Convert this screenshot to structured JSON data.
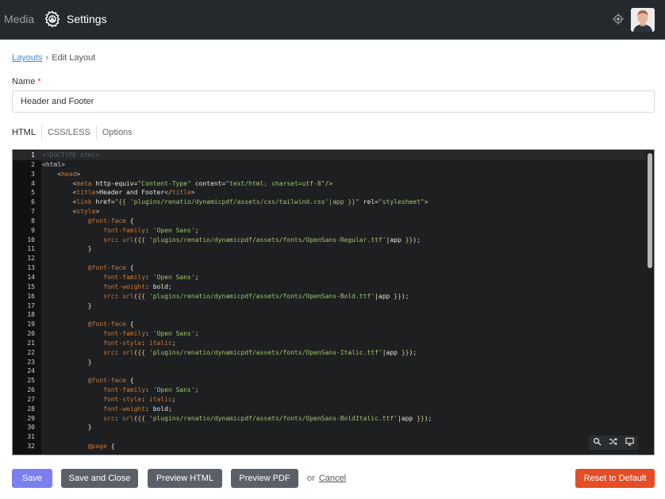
{
  "topbar": {
    "media_label": "Media",
    "settings_label": "Settings",
    "avatar_alt": "User avatar"
  },
  "breadcrumb": {
    "parent": "Layouts",
    "current": "Edit Layout"
  },
  "form": {
    "name_label": "Name",
    "required_mark": "*",
    "name_value": "Header and Footer"
  },
  "tabs": [
    "HTML",
    "CSS/LESS",
    "Options"
  ],
  "editor": {
    "lines": [
      {
        "n": "1",
        "html": "<span class=\"k-comment\">&lt;!DOCTYPE html&gt;</span>"
      },
      {
        "n": "2",
        "html": "<span class=\"k-tag\">&lt;html&gt;</span>"
      },
      {
        "n": "3",
        "html": "    <span class=\"k-tag\">&lt;</span><span class=\"k-tagname\">head</span><span class=\"k-tag\">&gt;</span>"
      },
      {
        "n": "4",
        "html": "        <span class=\"k-tag\">&lt;</span><span class=\"k-tagname\">meta</span> <span class=\"k-attr\">http-equiv</span>=<span class=\"k-str\">\"Content-Type\"</span> <span class=\"k-attr\">content</span>=<span class=\"k-str\">\"text/html; charset=utf-8\"</span><span class=\"k-tag\">/&gt;</span>"
      },
      {
        "n": "5",
        "html": "        <span class=\"k-tag\">&lt;</span><span class=\"k-tagname\">title</span><span class=\"k-tag\">&gt;</span>Header and Footer<span class=\"k-tag\">&lt;/</span><span class=\"k-tagname\">title</span><span class=\"k-tag\">&gt;</span>"
      },
      {
        "n": "6",
        "html": "        <span class=\"k-tag\">&lt;</span><span class=\"k-tagname\">link</span> <span class=\"k-attr\">href</span>=<span class=\"k-str\">\"{{ 'plugins/renatio/dynamicpdf/assets/css/tailwind.css'|app }}\"</span> <span class=\"k-attr\">rel</span>=<span class=\"k-str\">\"stylesheet\"</span><span class=\"k-tag\">&gt;</span>"
      },
      {
        "n": "7",
        "html": "        <span class=\"k-tag\">&lt;</span><span class=\"k-tagname\">style</span><span class=\"k-tag\">&gt;</span>"
      },
      {
        "n": "8",
        "html": "            <span class=\"k-sel\">@font-face</span> {"
      },
      {
        "n": "9",
        "html": "                <span class=\"k-prop\">font-family</span>: <span class=\"k-str\">'Open Sans'</span>;"
      },
      {
        "n": "10",
        "html": "                <span class=\"k-prop\">src</span>: <span class=\"k-kw\">url</span>(<span class=\"k-twig\">{{</span> <span class=\"k-str\">'plugins/renatio/dynamicpdf/assets/fonts/OpenSans-Regular.ttf'</span>|app <span class=\"k-twig\">}}</span>);"
      },
      {
        "n": "11",
        "html": "            }"
      },
      {
        "n": "12",
        "html": ""
      },
      {
        "n": "13",
        "html": "            <span class=\"k-sel\">@font-face</span> {"
      },
      {
        "n": "14",
        "html": "                <span class=\"k-prop\">font-family</span>: <span class=\"k-str\">'Open Sans'</span>;"
      },
      {
        "n": "15",
        "html": "                <span class=\"k-prop\">font-weight</span>: <span class=\"k-val\">bold</span>;"
      },
      {
        "n": "16",
        "html": "                <span class=\"k-prop\">src</span>: <span class=\"k-kw\">url</span>(<span class=\"k-twig\">{{</span> <span class=\"k-str\">'plugins/renatio/dynamicpdf/assets/fonts/OpenSans-Bold.ttf'</span>|app <span class=\"k-twig\">}}</span>);"
      },
      {
        "n": "17",
        "html": "            }"
      },
      {
        "n": "18",
        "html": ""
      },
      {
        "n": "19",
        "html": "            <span class=\"k-sel\">@font-face</span> {"
      },
      {
        "n": "20",
        "html": "                <span class=\"k-prop\">font-family</span>: <span class=\"k-str\">'Open Sans'</span>;"
      },
      {
        "n": "21",
        "html": "                <span class=\"k-prop\">font-style</span>: <span class=\"k-kw\">italic</span>;"
      },
      {
        "n": "22",
        "html": "                <span class=\"k-prop\">src</span>: <span class=\"k-kw\">url</span>(<span class=\"k-twig\">{{</span> <span class=\"k-str\">'plugins/renatio/dynamicpdf/assets/fonts/OpenSans-Italic.ttf'</span>|app <span class=\"k-twig\">}}</span>);"
      },
      {
        "n": "23",
        "html": "            }"
      },
      {
        "n": "24",
        "html": ""
      },
      {
        "n": "25",
        "html": "            <span class=\"k-sel\">@font-face</span> {"
      },
      {
        "n": "26",
        "html": "                <span class=\"k-prop\">font-family</span>: <span class=\"k-str\">'Open Sans'</span>;"
      },
      {
        "n": "27",
        "html": "                <span class=\"k-prop\">font-style</span>: <span class=\"k-kw\">italic</span>;"
      },
      {
        "n": "28",
        "html": "                <span class=\"k-prop\">font-weight</span>: <span class=\"k-val\">bold</span>;"
      },
      {
        "n": "29",
        "html": "                <span class=\"k-prop\">src</span>: <span class=\"k-kw\">url</span>(<span class=\"k-twig\">{{</span> <span class=\"k-str\">'plugins/renatio/dynamicpdf/assets/fonts/OpenSans-BoldItalic.ttf'</span>|app <span class=\"k-twig\">}}</span>);"
      },
      {
        "n": "30",
        "html": "            }"
      },
      {
        "n": "31",
        "html": ""
      },
      {
        "n": "32",
        "html": "            <span class=\"k-sel\">@page</span> {"
      }
    ]
  },
  "buttons": {
    "save": "Save",
    "save_close": "Save and Close",
    "preview_html": "Preview HTML",
    "preview_pdf": "Preview PDF",
    "or": "or",
    "cancel": "Cancel",
    "reset": "Reset to Default"
  },
  "colors": {
    "topbar": "#24292e",
    "primary": "#7b7ff0",
    "secondary": "#5b6068",
    "danger": "#e44d26",
    "link": "#3a8fd6"
  },
  "icons": {
    "settings": "gear-icon",
    "target": "crosshair-icon",
    "search": "search-icon",
    "shuffle": "shuffle-icon",
    "fullscreen": "monitor-icon"
  }
}
